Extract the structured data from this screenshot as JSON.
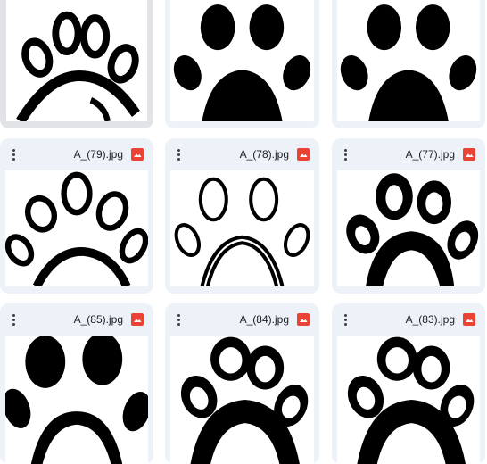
{
  "files": [
    {
      "name": "",
      "icon": "image-file-icon",
      "selected": true
    },
    {
      "name": "",
      "icon": "image-file-icon"
    },
    {
      "name": "",
      "icon": "image-file-icon"
    },
    {
      "name": "A_(79).jpg",
      "icon": "image-file-icon"
    },
    {
      "name": "A_(78).jpg",
      "icon": "image-file-icon"
    },
    {
      "name": "A_(77).jpg",
      "icon": "image-file-icon"
    },
    {
      "name": "A_(85).jpg",
      "icon": "image-file-icon"
    },
    {
      "name": "A_(84).jpg",
      "icon": "image-file-icon"
    },
    {
      "name": "A_(83).jpg",
      "icon": "image-file-icon"
    }
  ],
  "colors": {
    "card_bg": "#edf1f8",
    "card_selected_bg": "#e1e3e6",
    "image_icon": "#ea4335",
    "thumb_bg": "#ffffff",
    "paw": "#000000"
  }
}
